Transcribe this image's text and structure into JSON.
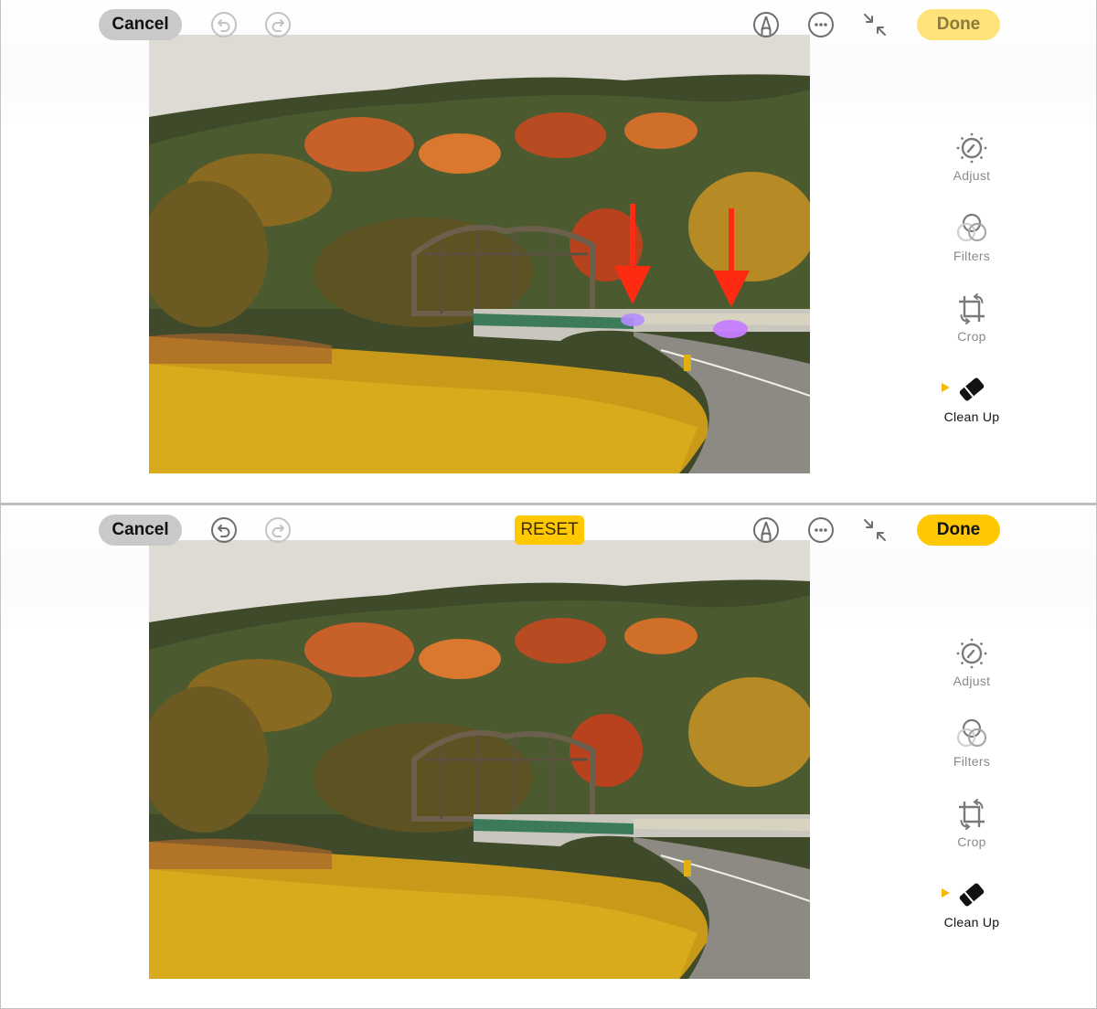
{
  "panels": [
    {
      "id": "before",
      "toolbar": {
        "cancel_label": "Cancel",
        "undo_icon": "undo-icon",
        "undo_enabled": false,
        "redo_icon": "redo-icon",
        "redo_enabled": false,
        "markup_icon": "markup-pen-icon",
        "more_icon": "more-ellipsis-icon",
        "collapse_icon": "collapse-arrows-icon",
        "done_label": "Done",
        "done_enabled": false
      },
      "photo": {
        "description": "Autumn forest with steel truss bridge and curving road",
        "annotations": [
          "red-arrow",
          "red-arrow"
        ],
        "highlighted_objects": [
          "car (purple highlight)",
          "car (purple highlight)"
        ]
      },
      "sidebar": {
        "tools": [
          {
            "label": "Adjust",
            "icon": "adjust-dial-icon",
            "active": false
          },
          {
            "label": "Filters",
            "icon": "filters-circles-icon",
            "active": false
          },
          {
            "label": "Crop",
            "icon": "crop-rotate-icon",
            "active": false
          },
          {
            "label": "Clean Up",
            "icon": "eraser-icon",
            "active": true
          }
        ]
      }
    },
    {
      "id": "after",
      "toolbar": {
        "cancel_label": "Cancel",
        "undo_icon": "undo-icon",
        "undo_enabled": true,
        "redo_icon": "redo-icon",
        "redo_enabled": false,
        "reset_label": "RESET",
        "markup_icon": "markup-pen-icon",
        "more_icon": "more-ellipsis-icon",
        "collapse_icon": "collapse-arrows-icon",
        "done_label": "Done",
        "done_enabled": true
      },
      "photo": {
        "description": "Autumn forest with steel truss bridge and curving road, cars removed"
      },
      "sidebar": {
        "tools": [
          {
            "label": "Adjust",
            "icon": "adjust-dial-icon",
            "active": false
          },
          {
            "label": "Filters",
            "icon": "filters-circles-icon",
            "active": false
          },
          {
            "label": "Crop",
            "icon": "crop-rotate-icon",
            "active": false
          },
          {
            "label": "Clean Up",
            "icon": "eraser-icon",
            "active": true
          }
        ]
      }
    }
  ],
  "colors": {
    "accent_yellow": "#ffc800",
    "accent_yellow_disabled": "#ffe27a",
    "active_marker": "#f5b800",
    "annotation_red": "#ff2a12",
    "highlight_purple": "#c77dff"
  }
}
